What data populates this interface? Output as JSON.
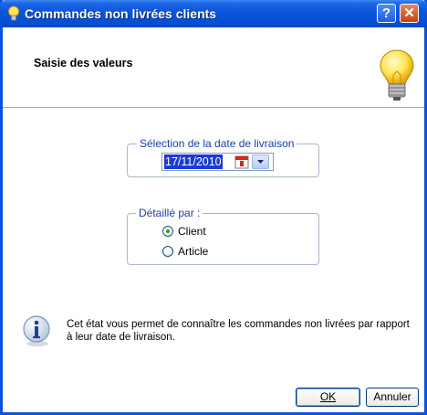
{
  "window": {
    "title": "Commandes non livrées clients"
  },
  "header": {
    "title": "Saisie des valeurs"
  },
  "date_group": {
    "legend": "Sélection de la date de livraison",
    "value": "17/11/2010"
  },
  "detail_group": {
    "legend": "Détaillé par :",
    "options": [
      {
        "label": "Client",
        "checked": true
      },
      {
        "label": "Article",
        "checked": false
      }
    ]
  },
  "info": {
    "text": "Cet état vous permet de connaître les commandes non livrées par rapport à leur date de livraison."
  },
  "buttons": {
    "ok": "OK",
    "cancel": "Annuler"
  },
  "colors": {
    "titlebar": "#0a54d9",
    "legend": "#1c3fa8",
    "selection": "#1c3ad3"
  }
}
